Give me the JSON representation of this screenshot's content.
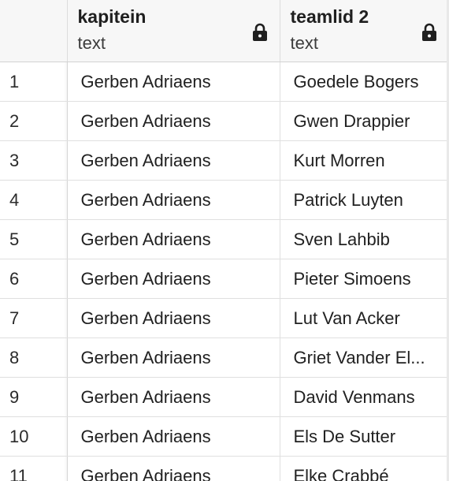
{
  "columns": [
    {
      "name": "kapitein",
      "type": "text",
      "icon": "lock-icon"
    },
    {
      "name": "teamlid 2",
      "type": "text",
      "icon": "lock-icon"
    }
  ],
  "rows": [
    {
      "index": "1",
      "kapitein": "Gerben Adriaens",
      "teamlid2": "Goedele Bogers"
    },
    {
      "index": "2",
      "kapitein": "Gerben Adriaens",
      "teamlid2": "Gwen Drappier"
    },
    {
      "index": "3",
      "kapitein": "Gerben Adriaens",
      "teamlid2": "Kurt Morren"
    },
    {
      "index": "4",
      "kapitein": "Gerben Adriaens",
      "teamlid2": "Patrick Luyten"
    },
    {
      "index": "5",
      "kapitein": "Gerben Adriaens",
      "teamlid2": "Sven Lahbib"
    },
    {
      "index": "6",
      "kapitein": "Gerben Adriaens",
      "teamlid2": "Pieter Simoens"
    },
    {
      "index": "7",
      "kapitein": "Gerben Adriaens",
      "teamlid2": "Lut Van Acker"
    },
    {
      "index": "8",
      "kapitein": "Gerben Adriaens",
      "teamlid2": "Griet Vander El..."
    },
    {
      "index": "9",
      "kapitein": "Gerben Adriaens",
      "teamlid2": "David Venmans"
    },
    {
      "index": "10",
      "kapitein": "Gerben Adriaens",
      "teamlid2": "Els De Sutter"
    },
    {
      "index": "11",
      "kapitein": "Gerben Adriaens",
      "teamlid2": "Elke Crabbé"
    }
  ]
}
